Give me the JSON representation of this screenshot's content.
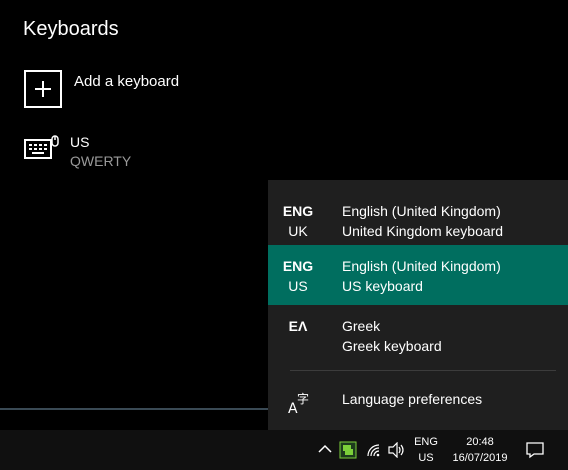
{
  "settings": {
    "heading": "Keyboards",
    "add_keyboard": "Add a keyboard",
    "keyboard_name": "US",
    "keyboard_layout": "QWERTY"
  },
  "flyout": {
    "items": [
      {
        "code_line1": "ENG",
        "code_line2": "UK",
        "language": "English (United Kingdom)",
        "keyboard": "United Kingdom keyboard",
        "selected": false
      },
      {
        "code_line1": "ENG",
        "code_line2": "US",
        "language": "English (United Kingdom)",
        "keyboard": "US keyboard",
        "selected": true
      },
      {
        "code_line1": "ΕΛ",
        "code_line2": "",
        "language": "Greek",
        "keyboard": "Greek keyboard",
        "selected": false
      }
    ],
    "preferences": "Language preferences",
    "accent_color": "#006e5f"
  },
  "taskbar": {
    "lang_line1": "ENG",
    "lang_line2": "US",
    "time": "20:48",
    "date": "16/07/2019",
    "icons": [
      "chevron-up-icon",
      "app-tray-icon",
      "wifi-icon",
      "volume-icon",
      "notification-icon"
    ]
  }
}
